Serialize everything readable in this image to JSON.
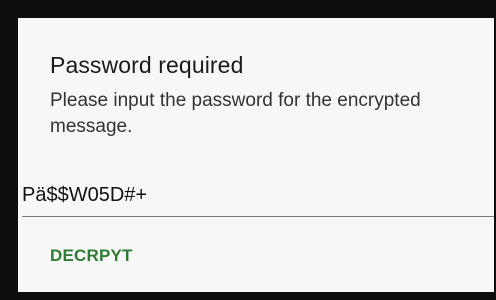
{
  "dialog": {
    "title": "Password required",
    "message": "Please input the password for the encrypted message.",
    "password": {
      "value": "Pä$$W05D#+",
      "placeholder": ""
    },
    "actions": {
      "decrypt_label": "DECRPYT"
    },
    "colors": {
      "accent": "#2e7d32",
      "background": "#f7f7f7",
      "overlay": "#0d0d0d"
    }
  }
}
